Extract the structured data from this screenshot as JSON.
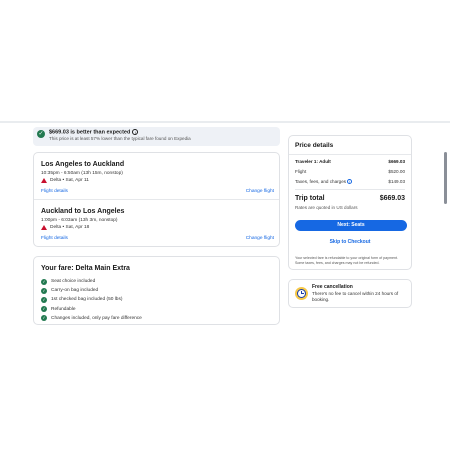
{
  "price_banner": {
    "title": "$669.03 is better than expected",
    "subtitle": "This price is at least 57% lower than the typical fare found on Expedia",
    "info_icon": "info-icon",
    "check_icon": "check-circle-icon"
  },
  "flights": [
    {
      "route": "Los Angeles to Auckland",
      "times": "10:35pm - 6:50am (13h 15m, nonstop)",
      "airline_date": "Delta • Sat, Apr 11",
      "details_link": "Flight details",
      "change_link": "Change flight"
    },
    {
      "route": "Auckland to Los Angeles",
      "times": "1:00pm - 6:03am (13h 3m, nonstop)",
      "airline_date": "Delta • Sat, Apr 18",
      "details_link": "Flight details",
      "change_link": "Change flight"
    }
  ],
  "fare": {
    "title": "Your fare: Delta Main Extra",
    "features": [
      "Seat choice included",
      "Carry-on bag included",
      "1st checked bag included (50 lbs)",
      "Refundable",
      "Changes included, only pay fare difference"
    ]
  },
  "price_details": {
    "title": "Price details",
    "traveler_label": "Traveler 1: Adult",
    "traveler_value": "$669.03",
    "flight_label": "Flight",
    "flight_value": "$520.00",
    "taxes_label": "Taxes, fees, and charges",
    "taxes_value": "$149.03",
    "total_label": "Trip total",
    "total_value": "$669.03",
    "rates_note": "Rates are quoted in US dollars",
    "next_button": "Next: Seats",
    "skip_link": "Skip to Checkout",
    "refund_note": "Your selected fare is refundable to your original form of payment. Some taxes, fees, and charges may not be refunded."
  },
  "cancellation": {
    "title": "Free cancellation",
    "text": "There's no fee to cancel within 24 hours of booking."
  },
  "colors": {
    "accent": "#1668e3",
    "success": "#227950",
    "delta_red": "#c8102e"
  }
}
